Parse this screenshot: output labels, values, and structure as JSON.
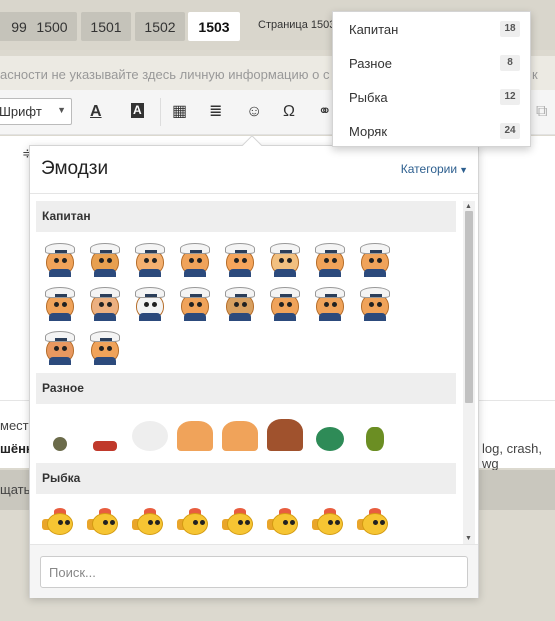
{
  "pager": {
    "pages": [
      "99",
      "1500",
      "1501",
      "1502",
      "1503"
    ],
    "current_page": "1503",
    "label": "Страница 1503"
  },
  "notice": {
    "text": "асности не указывайте здесь личную информацию о с",
    "right_fragment": "к"
  },
  "toolbar": {
    "font_label": "Шрифт"
  },
  "background_fragments": {
    "left_line1": "мести",
    "left_line2": "шённ",
    "left_line3": "щатьс",
    "right_tags": "log, crash, wg"
  },
  "emoji_popup": {
    "title": "Эмодзи",
    "categories_button": "Категории",
    "search_placeholder": "Поиск...",
    "sections": [
      {
        "name": "Капитан",
        "count": 18
      },
      {
        "name": "Разное",
        "count": 8
      },
      {
        "name": "Рыбка",
        "count": 12
      }
    ]
  },
  "category_menu": {
    "items": [
      {
        "label": "Капитан",
        "count": "18"
      },
      {
        "label": "Разное",
        "count": "8"
      },
      {
        "label": "Рыбка",
        "count": "12"
      },
      {
        "label": "Моряк",
        "count": "24"
      }
    ]
  }
}
